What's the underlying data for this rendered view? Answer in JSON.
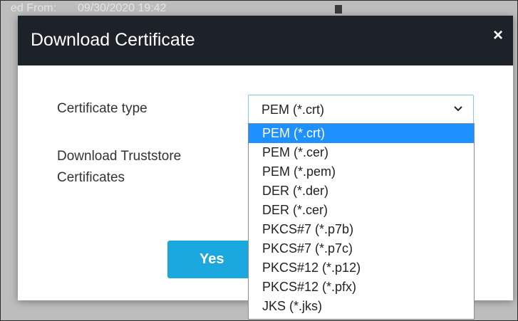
{
  "background": {
    "field_label": "ed From:",
    "field_value": "09/30/2020 19:42"
  },
  "dialog": {
    "title": "Download Certificate",
    "close_icon": "×",
    "certificate_type_label": "Certificate type",
    "download_truststore_label": "Download Truststore Certificates",
    "yes_button": "Yes",
    "selected_value": "PEM (*.crt)",
    "options": [
      "PEM (*.crt)",
      "PEM (*.cer)",
      "PEM (*.pem)",
      "DER (*.der)",
      "DER (*.cer)",
      "PKCS#7 (*.p7b)",
      "PKCS#7 (*.p7c)",
      "PKCS#12 (*.p12)",
      "PKCS#12 (*.pfx)",
      "JKS (*.jks)"
    ]
  },
  "colors": {
    "header_bg": "#1c2227",
    "accent": "#1aa8df",
    "highlight": "#1e90ff",
    "select_border": "#7fc8ee"
  }
}
